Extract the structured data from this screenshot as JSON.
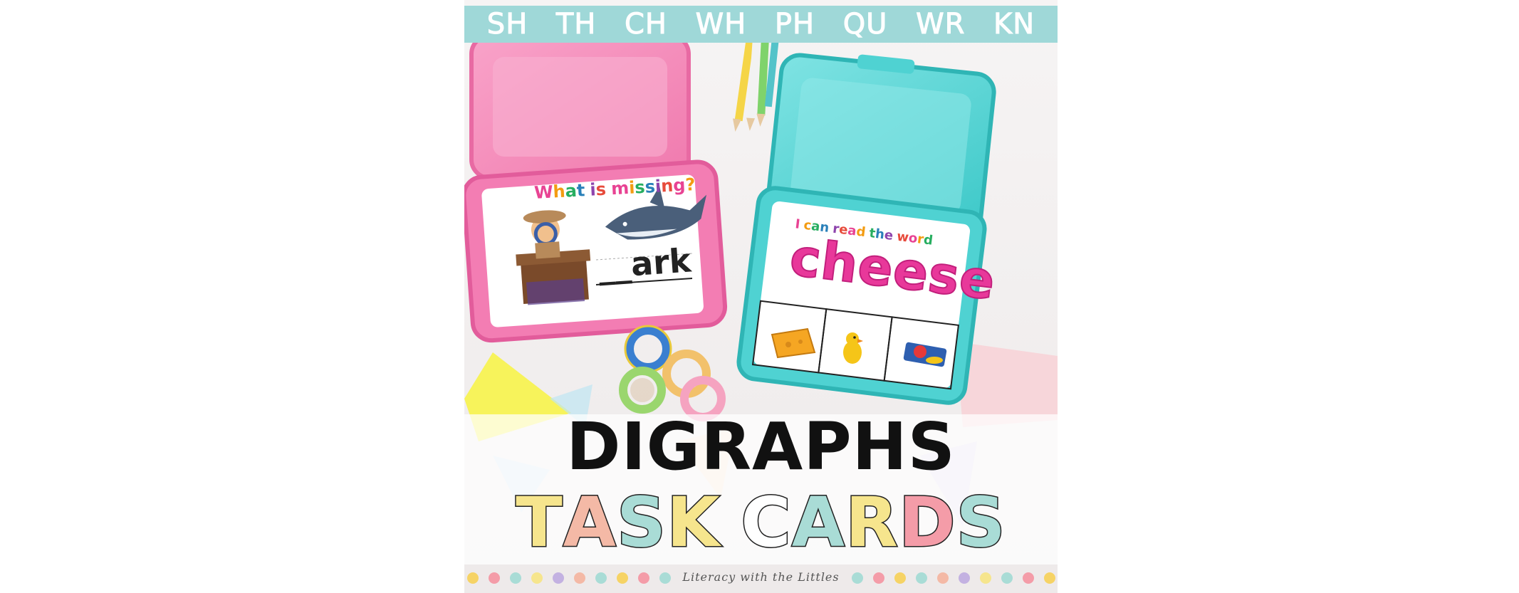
{
  "banner": {
    "digraphs": [
      "SH",
      "TH",
      "CH",
      "WH",
      "PH",
      "QU",
      "WR",
      "KN"
    ]
  },
  "pink_card": {
    "title_letters": [
      "W",
      "h",
      "a",
      "t",
      " ",
      "i",
      "s",
      " ",
      "m",
      "i",
      "s",
      "s",
      "i",
      "n",
      "g",
      "?"
    ],
    "answer": "__ark"
  },
  "teal_card": {
    "title_letters": [
      "I",
      " ",
      "c",
      "a",
      "n",
      " ",
      "r",
      "e",
      "a",
      "d",
      " ",
      "t",
      "h",
      "e",
      " ",
      "w",
      "o",
      "r",
      "d"
    ],
    "word": "cheese"
  },
  "title": {
    "line1": "DIGRAPHS",
    "line2_letters": [
      "T",
      "A",
      "S",
      "K",
      " ",
      "C",
      "A",
      "R",
      "D",
      "S"
    ]
  },
  "footer": {
    "text": "Literacy with the Littles"
  },
  "colors": {
    "banner": "#9fd8d8",
    "pink_case": "#f47fb4",
    "teal_case": "#4fd2d2",
    "title_palette": [
      "#f6e58d",
      "#f4b9a6",
      "#a9dcd6",
      "#f6e58d",
      "#ffffff",
      "#a9dcd6",
      "#f6e58d",
      "#f49ca8",
      "#a9dcd6",
      "#f49ca8"
    ],
    "rainbow": [
      "#e84393",
      "#f39c12",
      "#27ae60",
      "#2980b9",
      "#8e44ad",
      "#e74c3c"
    ],
    "dots": [
      "#f6d365",
      "#f49ca8",
      "#a9dcd6",
      "#f6e58d",
      "#c3b1e1",
      "#f4b9a6"
    ]
  },
  "icons": {
    "detective": "detective-icon",
    "shark": "shark-icon",
    "cheese": "cheese-icon",
    "chick": "chick-icon",
    "chips": "chips-icon"
  }
}
